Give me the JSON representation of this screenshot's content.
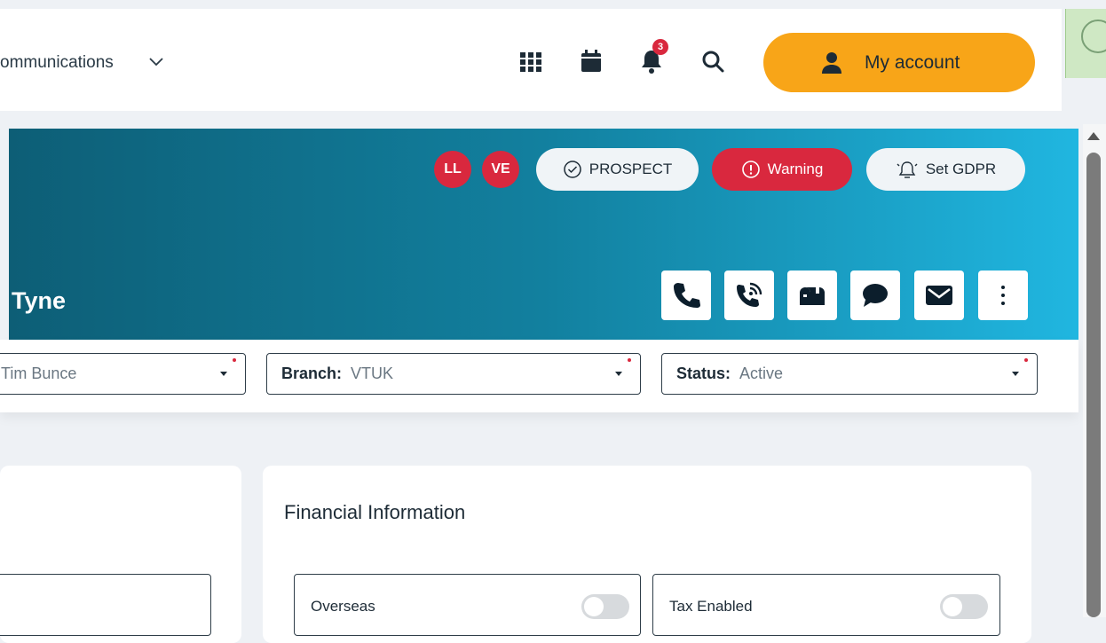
{
  "nav": {
    "label": "ommunications"
  },
  "topbar": {
    "notification_count": "3"
  },
  "account": {
    "label": "My account"
  },
  "hero": {
    "avatars": [
      "LL",
      "VE"
    ],
    "tags": {
      "prospect": "PROSPECT",
      "warning": "Warning",
      "gdpr": "Set GDPR"
    },
    "name": "Tyne"
  },
  "selects": [
    {
      "label": "",
      "value": "Tim Bunce"
    },
    {
      "label": "Branch:",
      "value": "VTUK"
    },
    {
      "label": "Status:",
      "value": "Active"
    }
  ],
  "financial": {
    "title": "Financial Information",
    "toggles": [
      {
        "label": "Overseas",
        "on": false
      },
      {
        "label": "Tax Enabled",
        "on": false
      }
    ]
  },
  "colors": {
    "accent": "#f8a518",
    "danger": "#d9283e",
    "banner_start": "#0d5e76",
    "banner_end": "#20b6e0"
  }
}
